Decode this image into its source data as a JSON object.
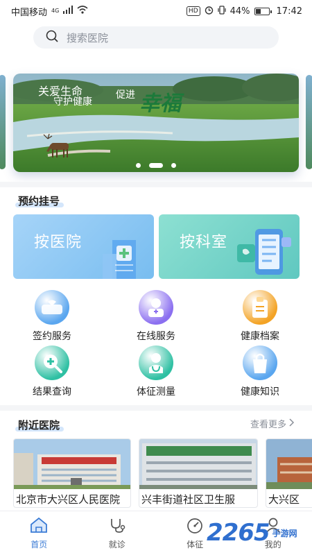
{
  "status_bar": {
    "carrier": "中国移动",
    "network": "4G",
    "hd": "HD",
    "battery": "44%",
    "battery_level": 0.44,
    "time": "17:42"
  },
  "search": {
    "placeholder": "搜索医院",
    "icon": "search-icon"
  },
  "banner": {
    "line1": "关爱生命",
    "line2": "守护健康",
    "line3": "促进",
    "line4": "幸福",
    "slide_count": 3,
    "active_slide": 2
  },
  "appointment": {
    "title": "预约挂号",
    "by_hospital": "按医院",
    "by_department": "按科室"
  },
  "services": [
    {
      "label": "签约服务",
      "icon": "handshake-icon",
      "color": "#5aa6ef"
    },
    {
      "label": "在线服务",
      "icon": "online-doctor-icon",
      "color": "#8b6ff0"
    },
    {
      "label": "健康档案",
      "icon": "clipboard-icon",
      "color": "#f3a325"
    },
    {
      "label": "结果查询",
      "icon": "search-plus-icon",
      "color": "#2fc0a3"
    },
    {
      "label": "体征测量",
      "icon": "stethoscope-doctor-icon",
      "color": "#2fc0a3"
    },
    {
      "label": "健康知识",
      "icon": "bag-icon",
      "color": "#5aa6ef"
    }
  ],
  "nearby": {
    "title": "附近医院",
    "more": "查看更多",
    "hospitals": [
      {
        "name": "北京市大兴区人民医院"
      },
      {
        "name": "兴丰街道社区卫生服"
      },
      {
        "name": "大兴区"
      }
    ]
  },
  "tabs": [
    {
      "label": "首页",
      "icon": "home-icon",
      "active": true
    },
    {
      "label": "就诊",
      "icon": "stethoscope-icon",
      "active": false
    },
    {
      "label": "体征",
      "icon": "gauge-icon",
      "active": false
    },
    {
      "label": "我的",
      "icon": "user-icon",
      "active": false
    }
  ],
  "watermark": {
    "big": "2265",
    "small": "手游网"
  },
  "colors": {
    "accent": "#3a7bd5",
    "teal": "#60c8c0",
    "sky": "#78bdf0"
  }
}
